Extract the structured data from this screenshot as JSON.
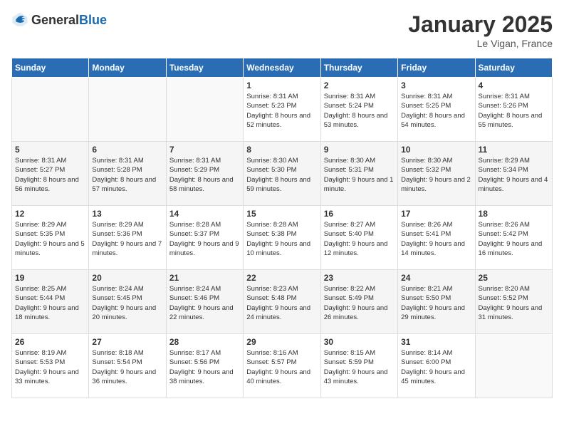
{
  "header": {
    "logo_general": "General",
    "logo_blue": "Blue",
    "title": "January 2025",
    "subtitle": "Le Vigan, France"
  },
  "days_of_week": [
    "Sunday",
    "Monday",
    "Tuesday",
    "Wednesday",
    "Thursday",
    "Friday",
    "Saturday"
  ],
  "weeks": [
    [
      {
        "day": "",
        "info": ""
      },
      {
        "day": "",
        "info": ""
      },
      {
        "day": "",
        "info": ""
      },
      {
        "day": "1",
        "info": "Sunrise: 8:31 AM\nSunset: 5:23 PM\nDaylight: 8 hours and 52 minutes."
      },
      {
        "day": "2",
        "info": "Sunrise: 8:31 AM\nSunset: 5:24 PM\nDaylight: 8 hours and 53 minutes."
      },
      {
        "day": "3",
        "info": "Sunrise: 8:31 AM\nSunset: 5:25 PM\nDaylight: 8 hours and 54 minutes."
      },
      {
        "day": "4",
        "info": "Sunrise: 8:31 AM\nSunset: 5:26 PM\nDaylight: 8 hours and 55 minutes."
      }
    ],
    [
      {
        "day": "5",
        "info": "Sunrise: 8:31 AM\nSunset: 5:27 PM\nDaylight: 8 hours and 56 minutes."
      },
      {
        "day": "6",
        "info": "Sunrise: 8:31 AM\nSunset: 5:28 PM\nDaylight: 8 hours and 57 minutes."
      },
      {
        "day": "7",
        "info": "Sunrise: 8:31 AM\nSunset: 5:29 PM\nDaylight: 8 hours and 58 minutes."
      },
      {
        "day": "8",
        "info": "Sunrise: 8:30 AM\nSunset: 5:30 PM\nDaylight: 8 hours and 59 minutes."
      },
      {
        "day": "9",
        "info": "Sunrise: 8:30 AM\nSunset: 5:31 PM\nDaylight: 9 hours and 1 minute."
      },
      {
        "day": "10",
        "info": "Sunrise: 8:30 AM\nSunset: 5:32 PM\nDaylight: 9 hours and 2 minutes."
      },
      {
        "day": "11",
        "info": "Sunrise: 8:29 AM\nSunset: 5:34 PM\nDaylight: 9 hours and 4 minutes."
      }
    ],
    [
      {
        "day": "12",
        "info": "Sunrise: 8:29 AM\nSunset: 5:35 PM\nDaylight: 9 hours and 5 minutes."
      },
      {
        "day": "13",
        "info": "Sunrise: 8:29 AM\nSunset: 5:36 PM\nDaylight: 9 hours and 7 minutes."
      },
      {
        "day": "14",
        "info": "Sunrise: 8:28 AM\nSunset: 5:37 PM\nDaylight: 9 hours and 9 minutes."
      },
      {
        "day": "15",
        "info": "Sunrise: 8:28 AM\nSunset: 5:38 PM\nDaylight: 9 hours and 10 minutes."
      },
      {
        "day": "16",
        "info": "Sunrise: 8:27 AM\nSunset: 5:40 PM\nDaylight: 9 hours and 12 minutes."
      },
      {
        "day": "17",
        "info": "Sunrise: 8:26 AM\nSunset: 5:41 PM\nDaylight: 9 hours and 14 minutes."
      },
      {
        "day": "18",
        "info": "Sunrise: 8:26 AM\nSunset: 5:42 PM\nDaylight: 9 hours and 16 minutes."
      }
    ],
    [
      {
        "day": "19",
        "info": "Sunrise: 8:25 AM\nSunset: 5:44 PM\nDaylight: 9 hours and 18 minutes."
      },
      {
        "day": "20",
        "info": "Sunrise: 8:24 AM\nSunset: 5:45 PM\nDaylight: 9 hours and 20 minutes."
      },
      {
        "day": "21",
        "info": "Sunrise: 8:24 AM\nSunset: 5:46 PM\nDaylight: 9 hours and 22 minutes."
      },
      {
        "day": "22",
        "info": "Sunrise: 8:23 AM\nSunset: 5:48 PM\nDaylight: 9 hours and 24 minutes."
      },
      {
        "day": "23",
        "info": "Sunrise: 8:22 AM\nSunset: 5:49 PM\nDaylight: 9 hours and 26 minutes."
      },
      {
        "day": "24",
        "info": "Sunrise: 8:21 AM\nSunset: 5:50 PM\nDaylight: 9 hours and 29 minutes."
      },
      {
        "day": "25",
        "info": "Sunrise: 8:20 AM\nSunset: 5:52 PM\nDaylight: 9 hours and 31 minutes."
      }
    ],
    [
      {
        "day": "26",
        "info": "Sunrise: 8:19 AM\nSunset: 5:53 PM\nDaylight: 9 hours and 33 minutes."
      },
      {
        "day": "27",
        "info": "Sunrise: 8:18 AM\nSunset: 5:54 PM\nDaylight: 9 hours and 36 minutes."
      },
      {
        "day": "28",
        "info": "Sunrise: 8:17 AM\nSunset: 5:56 PM\nDaylight: 9 hours and 38 minutes."
      },
      {
        "day": "29",
        "info": "Sunrise: 8:16 AM\nSunset: 5:57 PM\nDaylight: 9 hours and 40 minutes."
      },
      {
        "day": "30",
        "info": "Sunrise: 8:15 AM\nSunset: 5:59 PM\nDaylight: 9 hours and 43 minutes."
      },
      {
        "day": "31",
        "info": "Sunrise: 8:14 AM\nSunset: 6:00 PM\nDaylight: 9 hours and 45 minutes."
      },
      {
        "day": "",
        "info": ""
      }
    ]
  ]
}
